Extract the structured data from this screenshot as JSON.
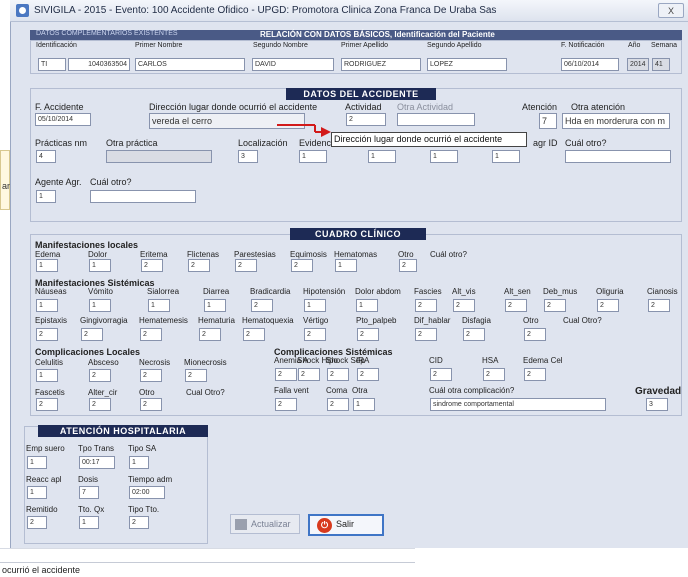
{
  "window": {
    "title": "SIVIGILA - 2015 - Evento: 100  Accidente Ofidico - UPGD: Promotora Clinica Zona Franca De Uraba  Sas",
    "close": "X"
  },
  "left_strip": {
    "text": "ar"
  },
  "header": {
    "left_label": "DATOS COMPLEMENTARIOS EXISTENTES",
    "title": "RELACIÓN CON DATOS BÁSICOS,  Identificación del Paciente"
  },
  "patient": {
    "labels": {
      "ident": "Identificación",
      "pnom": "Primer Nombre",
      "snom": "Segundo Nombre",
      "pape": "Primer Apellido",
      "sape": "Segundo Apellido",
      "fnot": "F. Notificación",
      "anio": "Año",
      "sem": "Semana"
    },
    "values": {
      "tipo": "TI",
      "num": "1040363504",
      "pnom": "CARLOS",
      "snom": "DAVID",
      "pape": "RODRIGUEZ",
      "sape": "LOPEZ",
      "fnot": "06/10/2014",
      "anio": "2014",
      "sem": "41"
    }
  },
  "accidente": {
    "title": "DATOS DEL ACCIDENTE",
    "labels": {
      "fecha": "F. Accidente",
      "dir": "Dirección lugar donde ocurrió el accidente",
      "act": "Actividad",
      "otraact": "Otra Actividad",
      "aten": "Atención",
      "otraaten": "Otra atención",
      "pract": "Prácticas nm",
      "otrapract": "Otra práctica",
      "loc": "Localización",
      "evid": "Evidenc",
      "agrid": "agr ID",
      "cualotro": "Cuál otro?",
      "agente": "Agente Agr.",
      "cualotro2": "Cuál otro?"
    },
    "values": {
      "fecha": "05/10/2014",
      "dir": "vereda el cerro",
      "act": "2",
      "aten": "7",
      "otraaten": "Hda en morderura con m",
      "pract": "4",
      "loc": "3",
      "evid": "1",
      "v1": "1",
      "v2": "1",
      "v3": "1",
      "agente": "1"
    }
  },
  "tooltip": "Dirección lugar donde ocurrió el accidente",
  "clinico": {
    "title": "CUADRO CLÍNICO",
    "loc_title": "Manifestaciones locales",
    "loc_labels": [
      "Edema",
      "Dolor",
      "Eritema",
      "Flictenas",
      "Parestesias",
      "Equimosis",
      "Hematomas",
      "Otro",
      "Cuál otro?"
    ],
    "loc_values": [
      "1",
      "1",
      "2",
      "2",
      "2",
      "2",
      "1",
      "2"
    ],
    "sis_title": "Manifestaciones Sistémicas",
    "sis_labels1": [
      "Náuseas",
      "Vómito",
      "Sialorrea",
      "Diarrea",
      "Bradicardia",
      "Hipotensión",
      "Dolor abdom",
      "Fascies",
      "Alt_vis",
      "Alt_sen",
      "Deb_mus",
      "Oliguria",
      "Cianosis"
    ],
    "sis_values1": [
      "1",
      "1",
      "1",
      "1",
      "2",
      "1",
      "1",
      "2",
      "2",
      "2",
      "2",
      "2",
      "2"
    ],
    "sis_labels2": [
      "Epistaxis",
      "Gingivorragia",
      "Hematemesis",
      "Hematuria",
      "Hematoquexia",
      "Vértigo",
      "Pto_palpeb",
      "Dif_hablar",
      "Disfagia",
      "Otro",
      "Cual Otro?"
    ],
    "sis_values2": [
      "2",
      "2",
      "2",
      "2",
      "2",
      "2",
      "2",
      "2",
      "2",
      "2"
    ],
    "comp_loc_title": "Complicaciones Locales",
    "comp_loc_labels1": [
      "Celulitis",
      "Absceso",
      "Necrosis",
      "Mionecrosis"
    ],
    "comp_loc_values1": [
      "1",
      "2",
      "2",
      "2"
    ],
    "comp_loc_labels2": [
      "Fascetis",
      "Alter_cir",
      "Otro",
      "Cual Otro?"
    ],
    "comp_loc_values2": [
      "2",
      "2",
      "2"
    ],
    "comp_sis_title": "Complicaciones Sistémicas",
    "comp_sis_labels1": [
      "Anemia A",
      "Shock Hipo",
      "Shock Sép",
      "IRA",
      "CID",
      "HSA",
      "Edema Cel"
    ],
    "comp_sis_values1": [
      "2",
      "2",
      "2",
      "2",
      "2",
      "2",
      "2"
    ],
    "comp_sis_labels2": [
      "Falla vent",
      "Coma",
      "Otra",
      "Cuál otra complicación?"
    ],
    "comp_sis_values2": [
      "2",
      "2",
      "1",
      "sindrome comportamental"
    ],
    "gravedad_label": "Gravedad",
    "gravedad_value": "3"
  },
  "hosp": {
    "title": "ATENCIÓN HOSPITALARIA",
    "labels": [
      "Emp suero",
      "Tpo Trans",
      "Tipo SA",
      "Reacc apl",
      "Dosis",
      "Tiempo adm",
      "Remitido",
      "Tto. Qx",
      "Tipo Tto."
    ],
    "values": [
      "1",
      "00:17",
      "1",
      "1",
      "7",
      "02:00",
      "2",
      "1",
      "2"
    ]
  },
  "buttons": {
    "actualizar": "Actualizar",
    "salir": "Salir"
  },
  "status": "ocurrió el accidente"
}
